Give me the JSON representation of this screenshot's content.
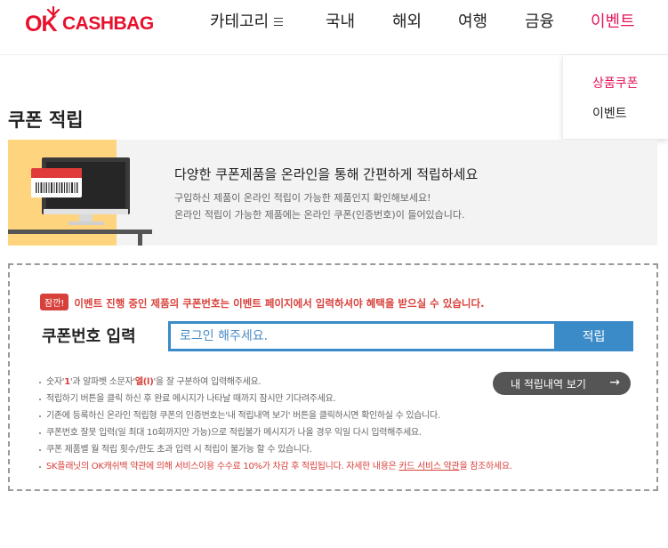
{
  "brand": {
    "ok": "OK",
    "cashbag": "CASHBAG"
  },
  "nav": {
    "items": [
      {
        "label": "카테고리",
        "active": false
      },
      {
        "label": "국내",
        "active": false
      },
      {
        "label": "해외",
        "active": false
      },
      {
        "label": "여행",
        "active": false
      },
      {
        "label": "금융",
        "active": false
      },
      {
        "label": "이벤트",
        "active": true
      }
    ],
    "dropdown": [
      {
        "label": "상품쿠폰",
        "active": true
      },
      {
        "label": "이벤트",
        "active": false
      }
    ]
  },
  "page": {
    "title": "쿠폰 적립"
  },
  "banner": {
    "headline": "다양한 쿠폰제품을 온라인을 통해 간편하게 적립하세요",
    "sub1": "구입하신 제품이 온라인 적립이 가능한 제품인지 확인해보세요!",
    "sub2": "온라인 적립이 가능한 제품에는 온라인 쿠폰(인증번호)이 들어있습니다."
  },
  "coupon": {
    "notice_badge": "잠깐!",
    "notice_text": "이벤트 진행 중인 제품의 쿠폰번호는 이벤트 페이지에서 입력하셔야 혜택을 받으실 수 있습니다.",
    "input_label": "쿠폰번호 입력",
    "input_placeholder": "로그인 해주세요.",
    "input_value": "",
    "submit_label": "적립",
    "history_label": "내 적립내역 보기",
    "history_arrow": "→"
  },
  "rules": {
    "r1_a": "숫자'",
    "r1_b": "1",
    "r1_c": "'과 알파벳 소문자'",
    "r1_d": "엘(l)",
    "r1_e": "'을 잘 구분하여 입력해주세요.",
    "r2": "적립하기 버튼을 클릭 하신 후 완료 메시지가 나타날 때까지 잠시만 기다려주세요.",
    "r3": "기존에 등록하신 온라인 적립형 쿠폰의 인증번호는'내 적립내역 보기' 버튼을 클릭하시면 확인하실 수 있습니다.",
    "r4": "쿠폰번호 잘못 입력(일 최대 10회까지만 가능)으로 적립불가 메시지가 나올 경우 익일 다시 입력해주세요.",
    "r5": "쿠폰 제품별 월 적립 횟수/한도 초과 입력 시 적립이 불가능 할 수 있습니다.",
    "r6_a": "SK플래닛의 OK캐쉬백 약관에 의해 서비스이용 수수료 10%가 차감 후 적립됩니다. 자세한 내용은 ",
    "r6_b": "카드 서비스 약관",
    "r6_c": "을 참조하세요."
  },
  "colors": {
    "brand_red": "#e8112d",
    "accent_pink": "#e3175a",
    "blue": "#3a8bc8",
    "notice_red": "#d8413b",
    "banner_yellow": "#ffd47f"
  },
  "icons": [
    "hamburger-icon",
    "arrow-right-icon",
    "monitor-illustration",
    "barcode-illustration"
  ]
}
